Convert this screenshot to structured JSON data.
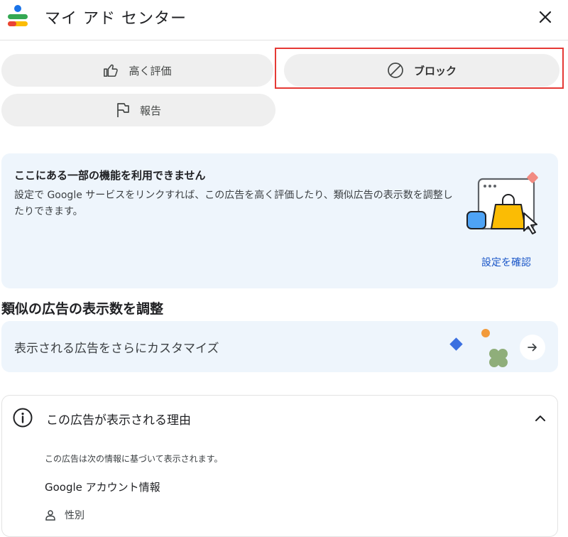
{
  "header": {
    "title": "マイ アド センター",
    "close_icon": "close-icon"
  },
  "actions": {
    "like_label": "高く評価",
    "block_label": "ブロック",
    "report_label": "報告"
  },
  "notice": {
    "title": "ここにある一部の機能を利用できません",
    "body": "設定で Google サービスをリンクすれば、この広告を高く評価したり、類似広告の表示数を調整したりできます。",
    "link": "設定を確認"
  },
  "similar": {
    "title": "類似の広告の表示数を調整",
    "customize_label": "表示される広告をさらにカスタマイズ"
  },
  "why": {
    "title": "この広告が表示される理由",
    "description": "この広告は次の情報に基づいて表示されます。",
    "subheading": "Google アカウント情報",
    "item": "性別"
  },
  "colors": {
    "accent_link": "#1a56c8",
    "panel_bg": "#eef5fc",
    "highlight_border": "#e53935"
  }
}
